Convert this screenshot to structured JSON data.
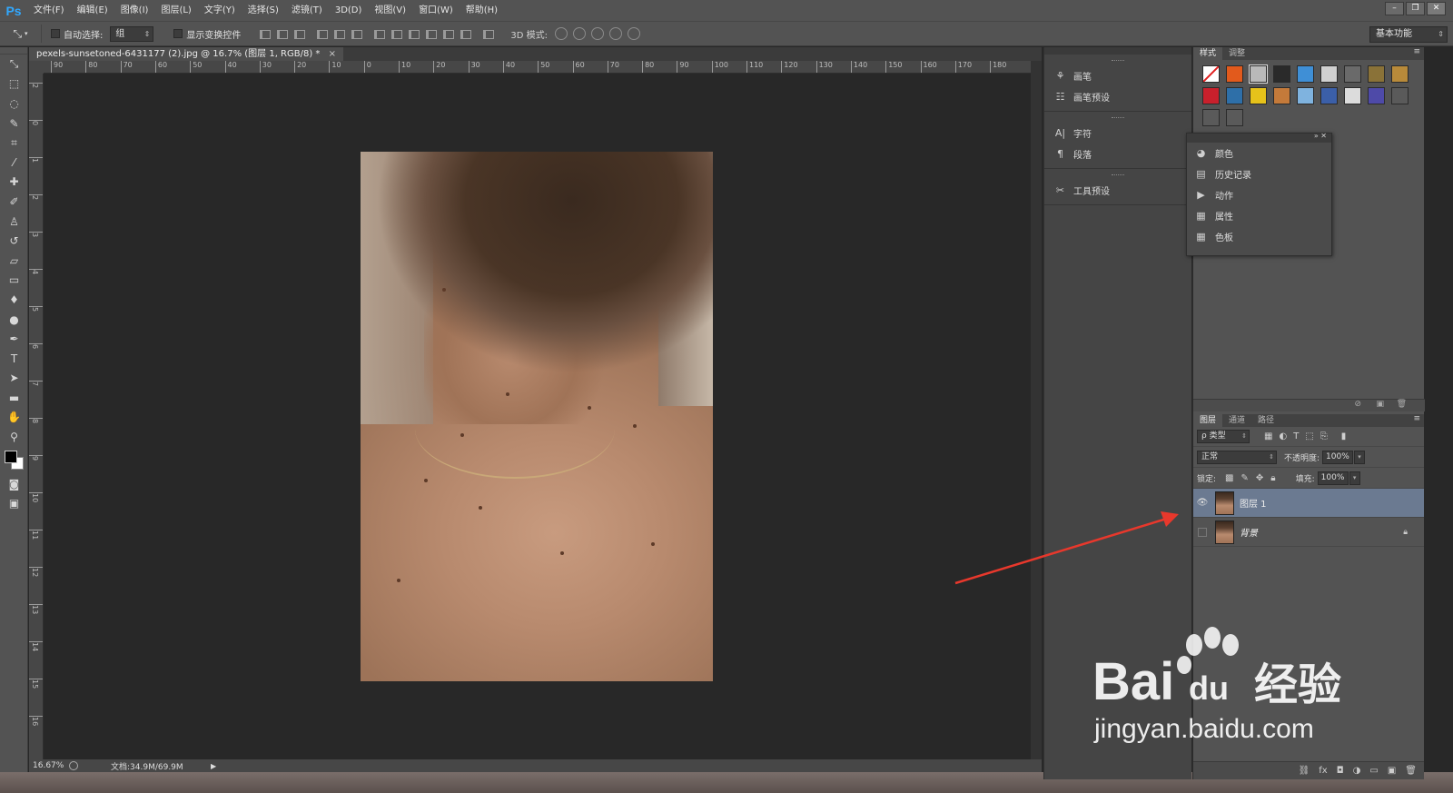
{
  "app": {
    "logo": "Ps"
  },
  "menu": [
    "文件(F)",
    "编辑(E)",
    "图像(I)",
    "图层(L)",
    "文字(Y)",
    "选择(S)",
    "滤镜(T)",
    "3D(D)",
    "视图(V)",
    "窗口(W)",
    "帮助(H)"
  ],
  "options": {
    "auto_select_label": "自动选择:",
    "auto_select_value": "组",
    "show_transform_label": "显示变换控件",
    "mode3d_label": "3D 模式:",
    "workspace": "基本功能"
  },
  "document": {
    "tab_title": "pexels-sunsetoned-6431177 (2).jpg @ 16.7% (图层 1, RGB/8) *",
    "zoom": "16.67%",
    "doc_info": "文档:34.9M/69.9M"
  },
  "rulers": {
    "horizontal": [
      "90",
      "80",
      "70",
      "60",
      "50",
      "40",
      "30",
      "20",
      "10",
      "0",
      "10",
      "20",
      "30",
      "40",
      "50",
      "60",
      "70",
      "80",
      "90",
      "100",
      "110",
      "120",
      "130",
      "140",
      "150",
      "160",
      "170",
      "180"
    ],
    "vertical": [
      "2",
      "0",
      "1",
      "2",
      "3",
      "4",
      "5",
      "6",
      "7",
      "8",
      "9",
      "10",
      "11",
      "12",
      "13",
      "14",
      "15",
      "16"
    ]
  },
  "dock": {
    "groups": [
      [
        {
          "icon": "brush-panel-icon",
          "label": "画笔"
        },
        {
          "icon": "brush-preset-icon",
          "label": "画笔预设"
        }
      ],
      [
        {
          "icon": "character-icon",
          "label": "字符"
        },
        {
          "icon": "paragraph-icon",
          "label": "段落"
        }
      ],
      [
        {
          "icon": "tool-preset-icon",
          "label": "工具预设"
        }
      ]
    ]
  },
  "styles_panel": {
    "tabs": [
      "样式",
      "调整"
    ],
    "swatches": [
      "#e8e8e8",
      "#e25a1c",
      "#b9b9b9",
      "#2a2a2a",
      "#3f8fd6",
      "#d0d0d0",
      "#6a6a6a",
      "#8a7238",
      "#b88a3a",
      "#c8202c",
      "#2e6fa8",
      "#e6c21a",
      "#c47a3a",
      "#7fb3df",
      "#3b5fa8",
      "#dcdcdc",
      "#4e4aa8",
      "#5a5a5a",
      "#5a5a5a",
      "#5a5a5a"
    ]
  },
  "float_panel": {
    "items": [
      {
        "icon": "color-icon",
        "label": "颜色"
      },
      {
        "icon": "history-icon",
        "label": "历史记录"
      },
      {
        "icon": "actions-icon",
        "label": "动作"
      },
      {
        "icon": "properties-icon",
        "label": "属性"
      },
      {
        "icon": "swatches-icon",
        "label": "色板"
      }
    ]
  },
  "layers_panel": {
    "tabs": [
      "图层",
      "通道",
      "路径"
    ],
    "filter_type": "ρ 类型",
    "blend_mode": "正常",
    "opacity_label": "不透明度:",
    "opacity": "100%",
    "lock_label": "锁定:",
    "fill_label": "填充:",
    "fill": "100%",
    "layers": [
      {
        "name": "图层 1",
        "visible": true,
        "selected": true,
        "locked": false
      },
      {
        "name": "背景",
        "visible": false,
        "selected": false,
        "locked": true
      }
    ]
  },
  "watermark": {
    "brand": "Bai",
    "brand_suffix": "du",
    "product": "经验",
    "url": "jingyan.baidu.com"
  },
  "colors": {
    "accent": "#31a8ff",
    "annotation_arrow": "#e8382c",
    "selected_layer": "#6b7a91"
  }
}
